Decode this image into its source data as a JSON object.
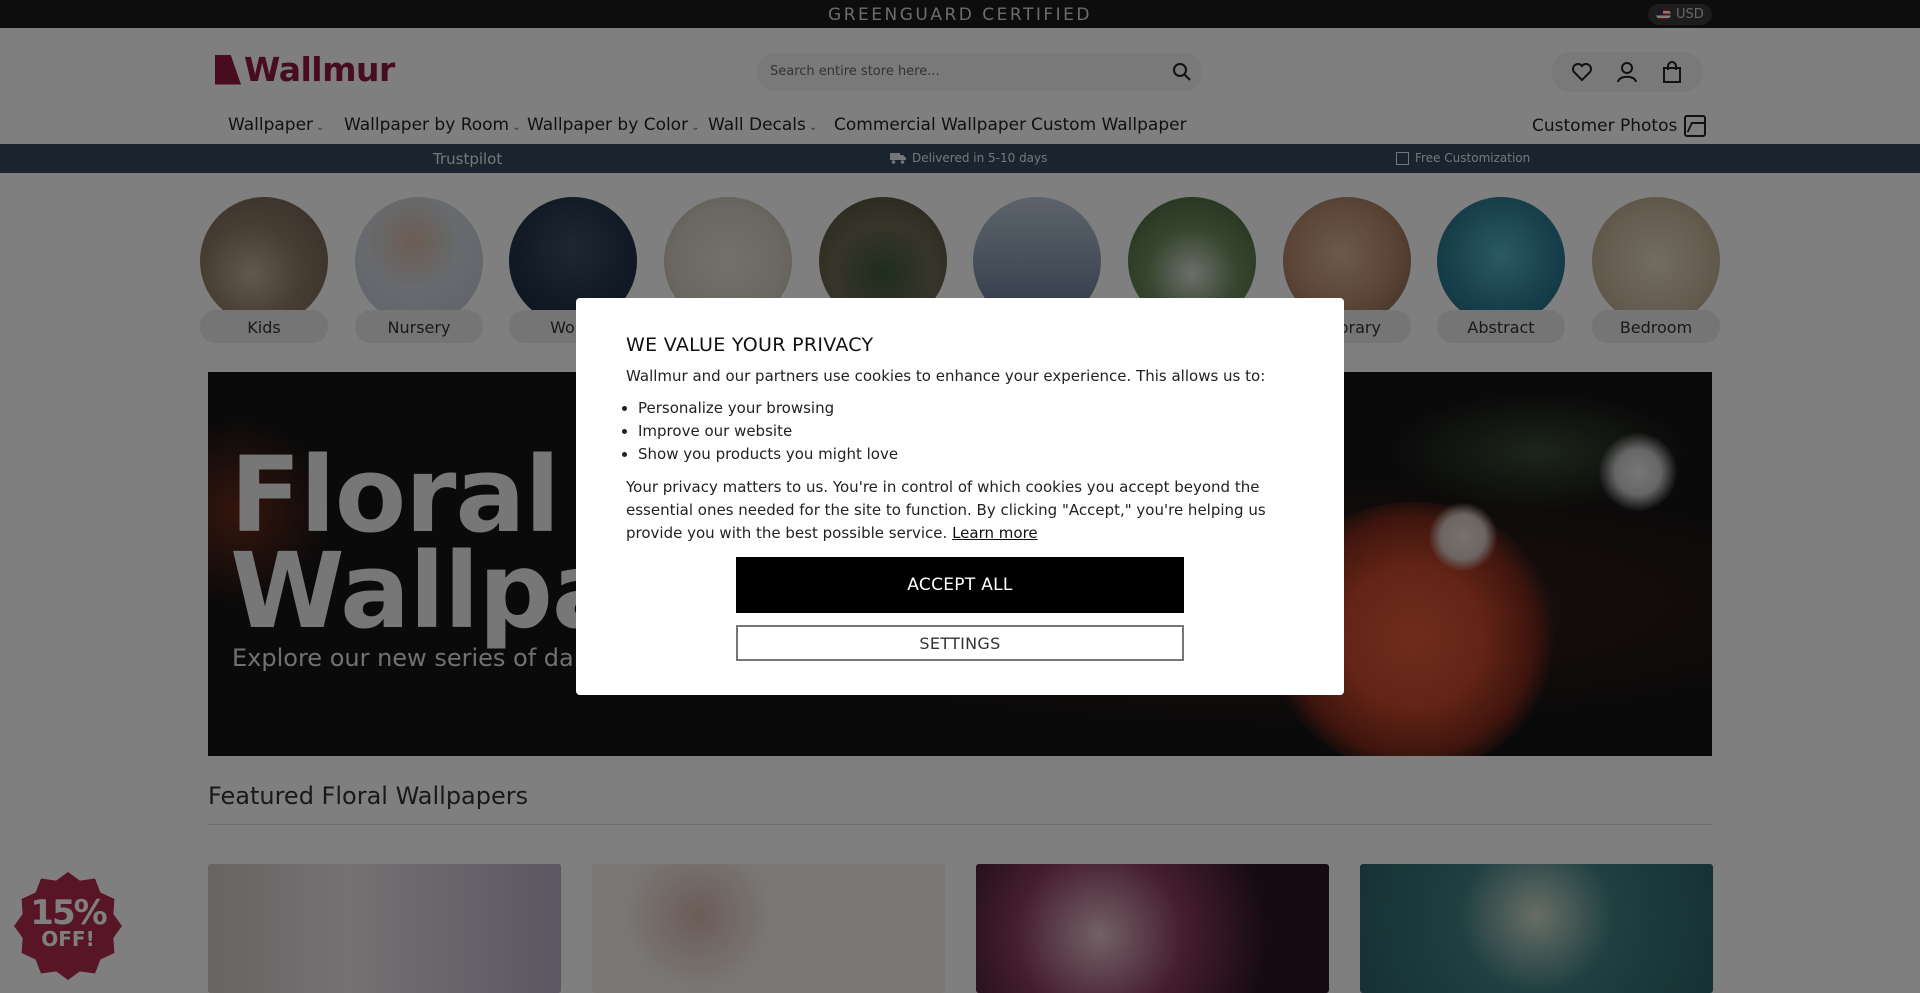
{
  "topbar": {
    "announcement": "GREENGUARD CERTIFIED",
    "currency": "USD"
  },
  "header": {
    "logo_text": "Wallmur",
    "search_placeholder": "Search entire store here...",
    "icons": [
      "heart-icon",
      "user-icon",
      "bag-icon"
    ]
  },
  "nav": {
    "items": [
      {
        "label": "Wallpaper",
        "has_dropdown": true
      },
      {
        "label": "Wallpaper by Room",
        "has_dropdown": true
      },
      {
        "label": "Wallpaper by Color",
        "has_dropdown": true
      },
      {
        "label": "Wall Decals",
        "has_dropdown": true
      },
      {
        "label": "Commercial Wallpaper",
        "has_dropdown": false
      },
      {
        "label": "Custom Wallpaper",
        "has_dropdown": false
      }
    ],
    "customer_photos": "Customer Photos"
  },
  "strip": {
    "trustpilot": "Trustpilot",
    "delivery": "Delivered in 5-10 days",
    "customization": "Free Customization"
  },
  "categories": [
    {
      "label": "Kids"
    },
    {
      "label": "Nursery"
    },
    {
      "label": "World"
    },
    {
      "label": ""
    },
    {
      "label": ""
    },
    {
      "label": ""
    },
    {
      "label": ""
    },
    {
      "label": "mporary"
    },
    {
      "label": "Abstract"
    },
    {
      "label": "Bedroom"
    }
  ],
  "hero": {
    "title_line1": "Floral",
    "title_line2": "Wallpap",
    "subtitle": "Explore our new series of dark flov"
  },
  "featured": {
    "heading": "Featured Floral Wallpapers"
  },
  "badge": {
    "percent": "15%",
    "off": "OFF!"
  },
  "modal": {
    "title": "WE VALUE YOUR PRIVACY",
    "intro": "Wallmur and our partners use cookies to enhance your experience. This allows us to:",
    "bullets": [
      "Personalize your browsing",
      "Improve our website",
      "Show you products you might love"
    ],
    "body": "Your privacy matters to us. You're in control of which cookies you accept beyond the essential ones needed for the site to function. By clicking \"Accept,\" you're helping us provide you with the best possible service.",
    "learn_more": "Learn more",
    "accept_label": "ACCEPT ALL",
    "settings_label": "SETTINGS"
  },
  "colors": {
    "brand": "#8e1b3c",
    "strip": "#34495e",
    "topbar": "#1a1a1a",
    "badge": "#b02a4a"
  }
}
